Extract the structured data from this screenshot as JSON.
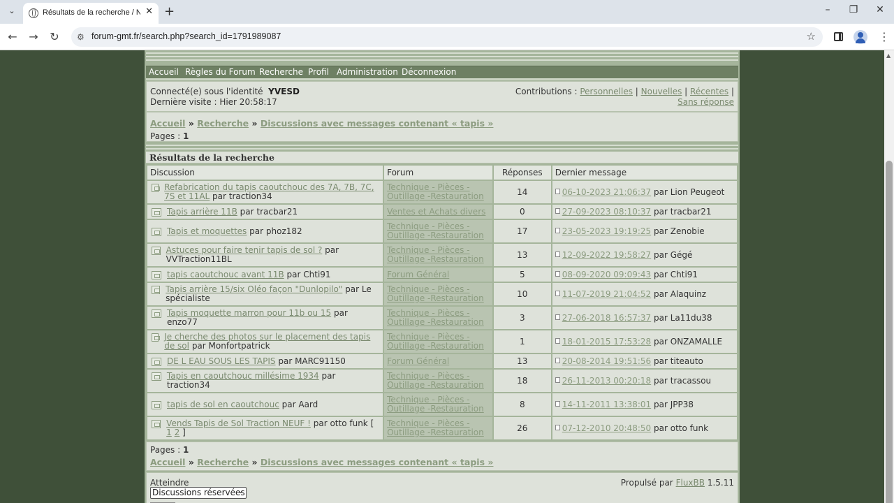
{
  "browser": {
    "tab_title": "Résultats de la recherche / Nou",
    "url": "forum-gmt.fr/search.php?search_id=1791989087"
  },
  "nav": {
    "items": [
      "Accueil",
      "Règles du Forum",
      "Recherche",
      "Profil",
      "Administration",
      "Déconnexion"
    ]
  },
  "welcome": {
    "connected_label": "Connecté(e) sous l'identité",
    "username": "YVESD",
    "last_visit": "Dernière visite : Hier 20:58:17",
    "contrib_label": "Contributions :",
    "contrib_links": [
      "Personnelles",
      "Nouvelles",
      "Récentes",
      "Sans réponse"
    ]
  },
  "crumbs": {
    "home": "Accueil",
    "search": "Recherche",
    "current": "Discussions avec messages contenant « tapis »",
    "sep": "»"
  },
  "pages": {
    "label": "Pages :",
    "value": "1"
  },
  "results": {
    "heading": "Résultats de la recherche",
    "columns": [
      "Discussion",
      "Forum",
      "Réponses",
      "Dernier message"
    ],
    "by": "par",
    "rows": [
      {
        "topic": "Refabrication du tapis caoutchouc des 7A, 7B, 7C, 7S et 11AL",
        "author": "traction34",
        "forum": "Technique - Pièces - Outillage -Restauration",
        "replies": "14",
        "last_date": "06-10-2023 21:06:37",
        "last_author": "Lion Peugeot"
      },
      {
        "topic": "Tapis arrière 11B",
        "author": "tracbar21",
        "forum": "Ventes et Achats divers",
        "replies": "0",
        "last_date": "27-09-2023 08:10:37",
        "last_author": "tracbar21"
      },
      {
        "topic": "Tapis et moquettes",
        "author": "phoz182",
        "forum": "Technique - Pièces - Outillage -Restauration",
        "replies": "17",
        "last_date": "23-05-2023 19:19:25",
        "last_author": "Zenobie"
      },
      {
        "topic": "Astuces pour faire tenir tapis de sol ?",
        "author": "VVTraction11BL",
        "forum": "Technique - Pièces - Outillage -Restauration",
        "replies": "13",
        "last_date": "12-09-2022 19:58:27",
        "last_author": "Gégé"
      },
      {
        "topic": "tapis caoutchouc avant 11B",
        "author": "Chti91",
        "forum": "Forum Général",
        "replies": "5",
        "last_date": "08-09-2020 09:09:43",
        "last_author": "Chti91"
      },
      {
        "topic": "Tapis arrière 15/six Oléo façon \"Dunlopilo\"",
        "author": "Le spécialiste",
        "forum": "Technique - Pièces - Outillage -Restauration",
        "replies": "10",
        "last_date": "11-07-2019 21:04:52",
        "last_author": "Alaquinz"
      },
      {
        "topic": "Tapis moquette marron pour 11b ou 15",
        "author": "enzo77",
        "forum": "Technique - Pièces - Outillage -Restauration",
        "replies": "3",
        "last_date": "27-06-2018 16:57:37",
        "last_author": "La11du38"
      },
      {
        "topic": "Je cherche des photos sur le placement des tapis de sol",
        "author": "Monfortpatrick",
        "forum": "Technique - Pièces - Outillage -Restauration",
        "replies": "1",
        "last_date": "18-01-2015 17:53:28",
        "last_author": "ONZAMALLE"
      },
      {
        "topic": "DE L EAU SOUS LES TAPIS",
        "author": "MARC91150",
        "forum": "Forum Général",
        "replies": "13",
        "last_date": "20-08-2014 19:51:56",
        "last_author": "titeauto"
      },
      {
        "topic": "Tapis en caoutchouc millésime 1934",
        "author": "traction34",
        "forum": "Technique - Pièces - Outillage -Restauration",
        "replies": "18",
        "last_date": "26-11-2013 00:20:18",
        "last_author": "tracassou"
      },
      {
        "topic": "tapis de sol en caoutchouc",
        "author": "Aard",
        "forum": "Technique - Pièces - Outillage -Restauration",
        "replies": "8",
        "last_date": "14-11-2011 13:38:01",
        "last_author": "JPP38"
      },
      {
        "topic": "Vends Tapis de Sol Traction NEUF !",
        "author": "otto funk",
        "pages_links": [
          "1",
          "2"
        ],
        "forum": "Technique - Pièces - Outillage -Restauration",
        "replies": "26",
        "last_date": "07-12-2010 20:48:50",
        "last_author": "otto funk"
      }
    ]
  },
  "footer": {
    "jump_label": "Atteindre",
    "jump_value": "Discussions réservées",
    "powered_label": "Propulsé par",
    "powered_link": "FluxBB",
    "version": "1.5.11"
  },
  "colors": {
    "page_bg": "#3f5039",
    "nav_bg": "#6e8063",
    "link": "#7a8a6f"
  }
}
